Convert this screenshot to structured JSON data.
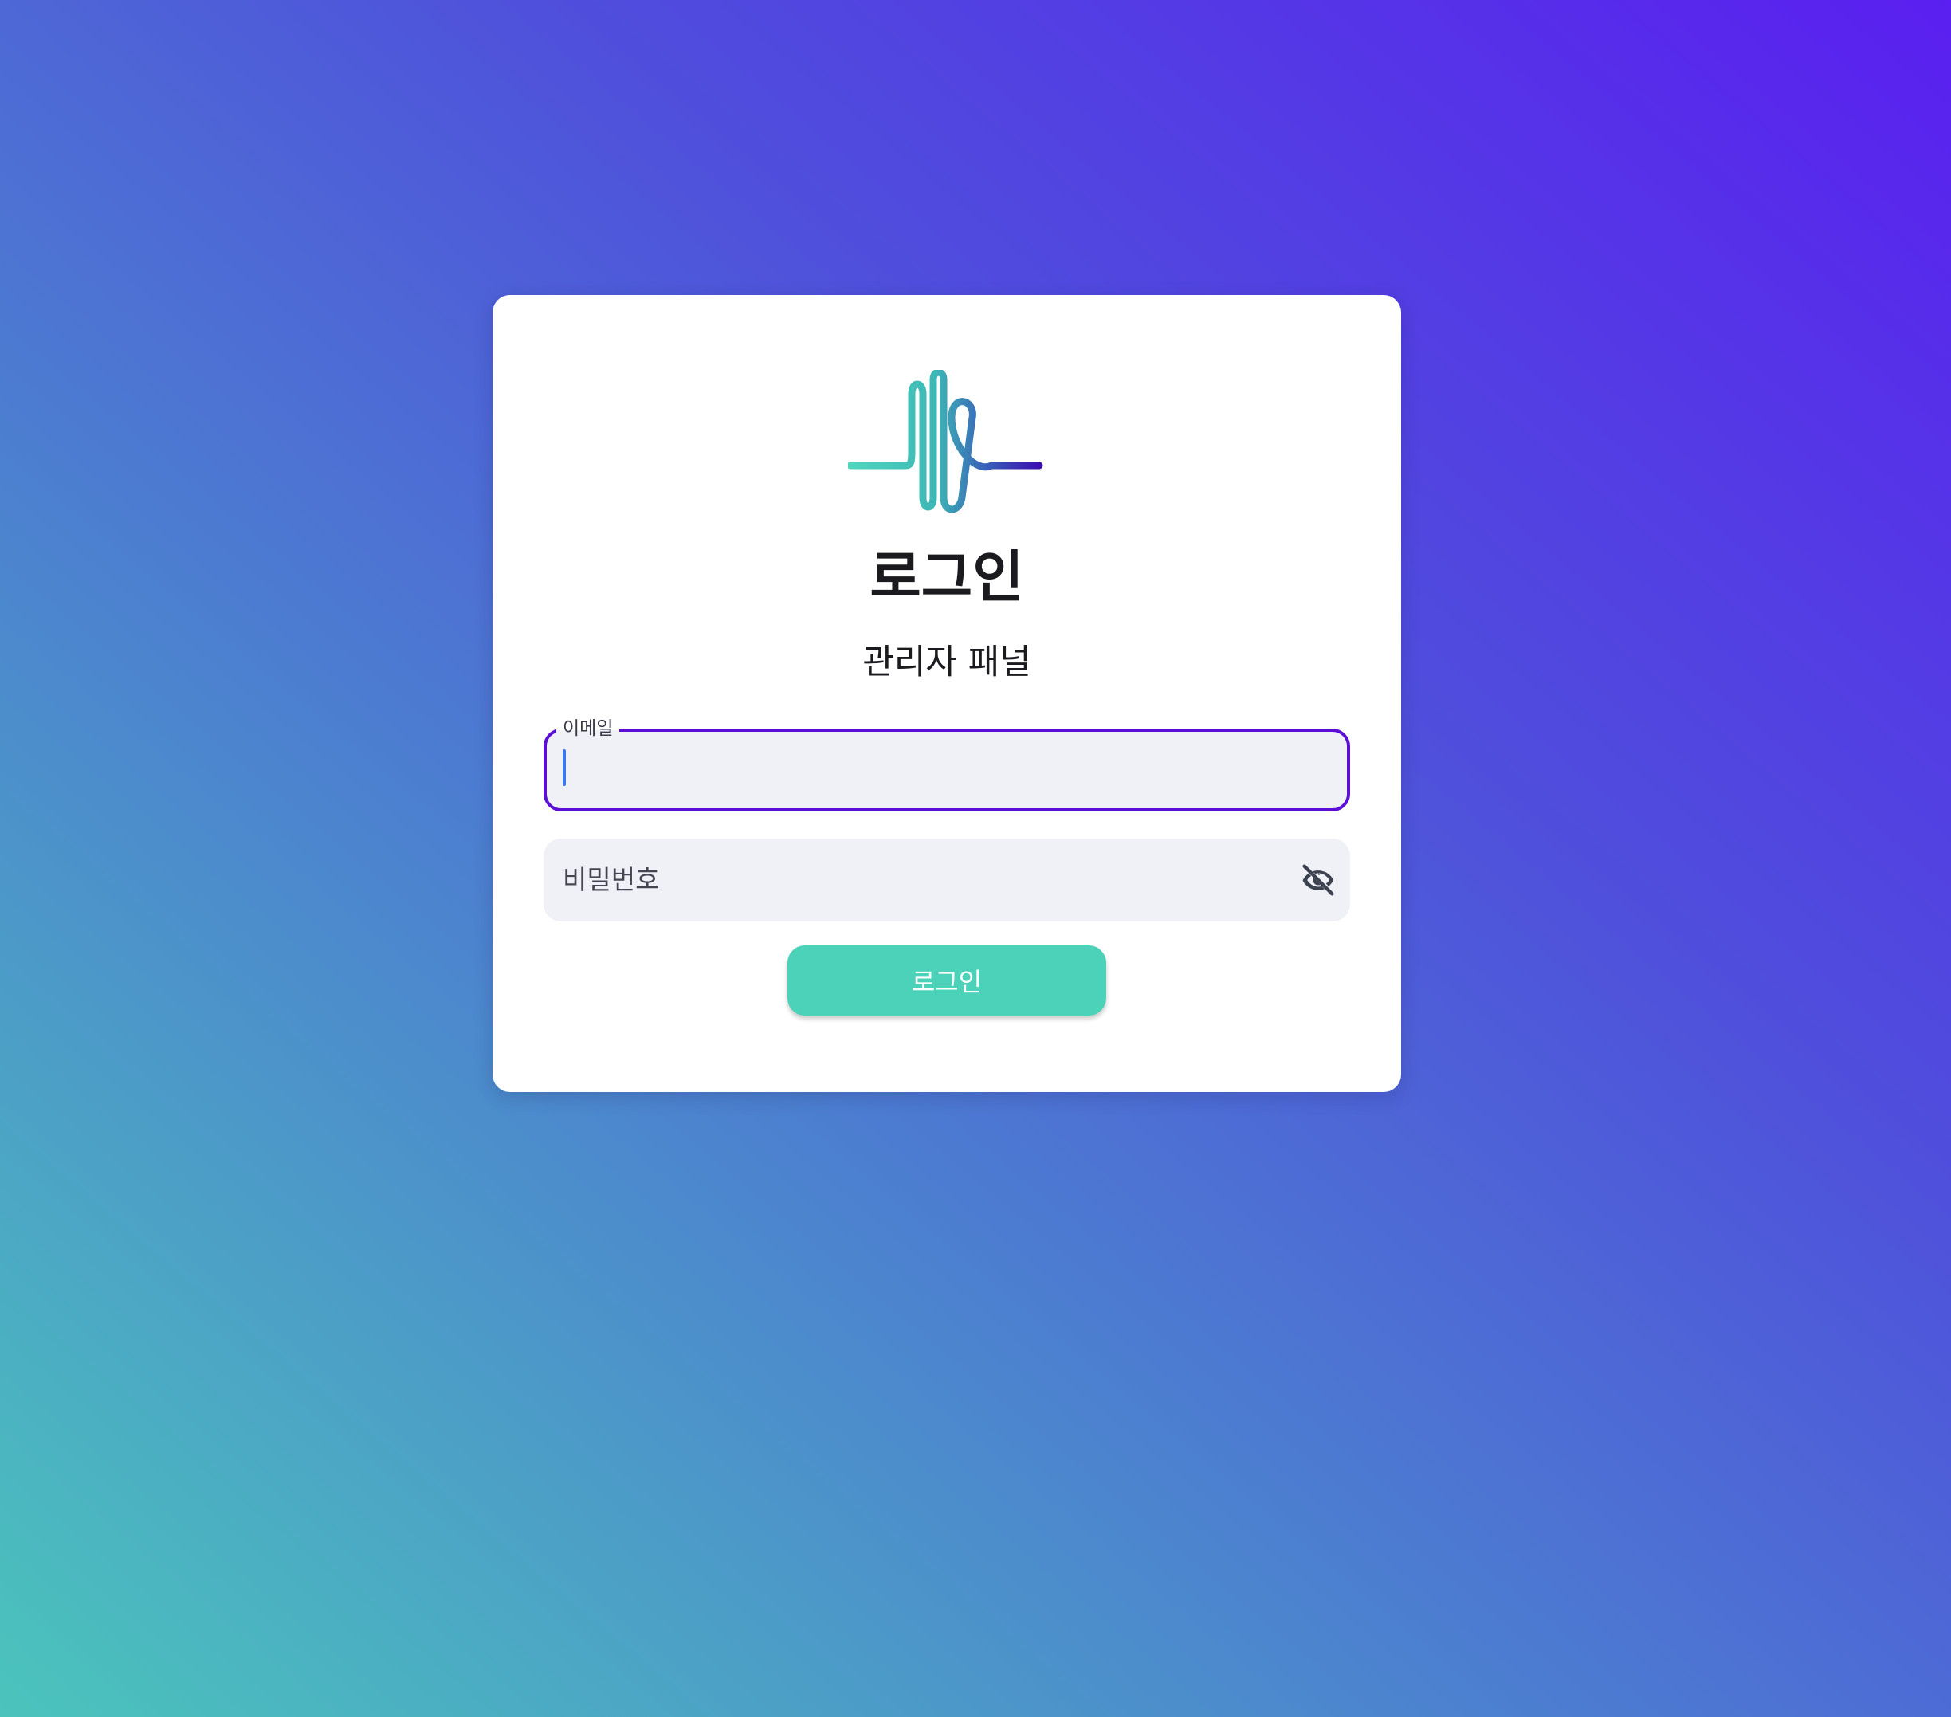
{
  "login_card": {
    "logo_icon": "waveform-logo-icon",
    "title": "로그인",
    "subtitle": "관리자 패널",
    "email_field": {
      "label": "이메일",
      "value": "",
      "state": "focused"
    },
    "password_field": {
      "placeholder": "비밀번호",
      "value": "",
      "toggle_icon": "eye-off-icon"
    },
    "login_button_label": "로그인"
  },
  "colors": {
    "background_gradient": [
      "#5a1ff0",
      "#4f4fdc",
      "#4c7fd0",
      "#4bc4bc"
    ],
    "focus_border": "#5b0fd6",
    "button": "#4bd2b9",
    "field_background": "#eff1f6"
  }
}
